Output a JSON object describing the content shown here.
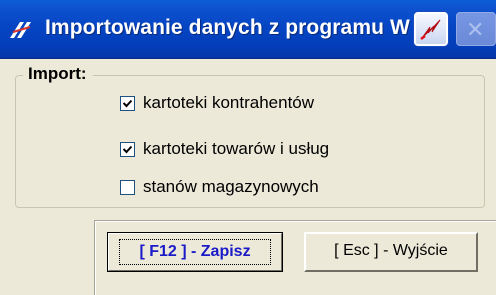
{
  "window": {
    "title": "Importowanie danych z programu W"
  },
  "titlebar": {
    "app_icon": "app-logo-icon",
    "help_icon": "lightning-icon",
    "close_icon": "close-icon"
  },
  "import_group": {
    "legend": "Import:",
    "options": [
      {
        "label": "kartoteki kontrahentów",
        "checked": true
      },
      {
        "label": "kartoteki towarów i usług",
        "checked": true
      },
      {
        "label": "stanów magazynowych",
        "checked": false
      }
    ]
  },
  "buttons": {
    "save_label": "[ F12 ] - Zapisz",
    "exit_label": "[ Esc ] - Wyjście"
  },
  "colors": {
    "titlebar": "#0545c4",
    "face": "#ece9d8",
    "save_text": "#1a1ac8"
  }
}
